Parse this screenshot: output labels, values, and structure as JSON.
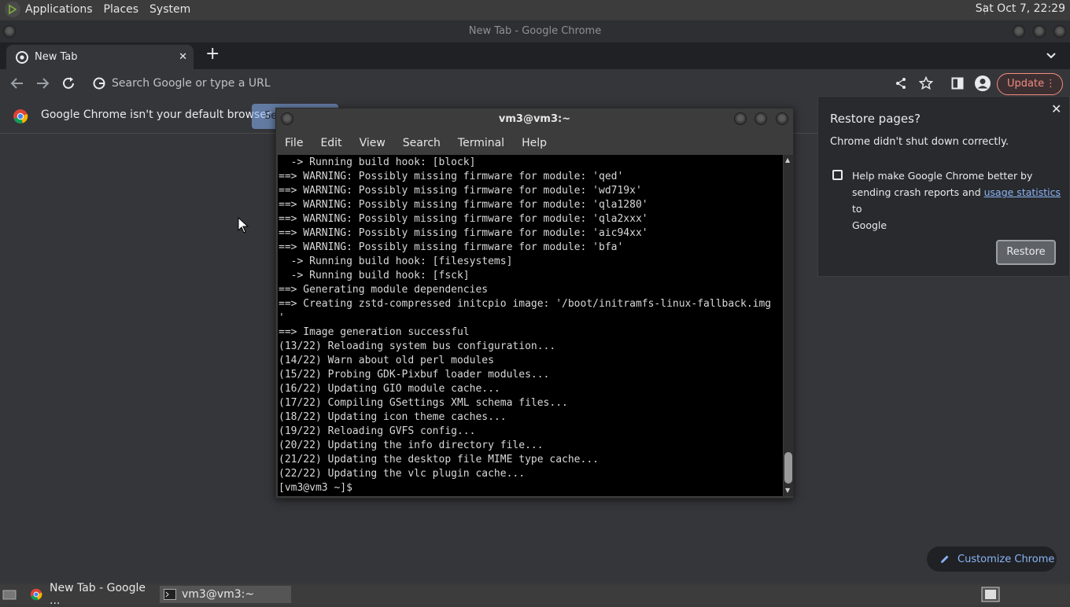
{
  "top_panel": {
    "menus": [
      "Applications",
      "Places",
      "System"
    ],
    "clock": "Sat Oct  7, 22:29"
  },
  "chrome": {
    "window_title": "New Tab - Google Chrome",
    "tab": {
      "title": "New Tab",
      "close": "✕"
    },
    "new_tab": "+",
    "omnibox_placeholder": "Search Google or type a URL",
    "update_label": "Update",
    "infobar": {
      "message": "Google Chrome isn't your default browser",
      "button": "Se"
    },
    "restore": {
      "title": "Restore pages?",
      "subtitle": "Chrome didn't shut down correctly.",
      "checkbox_text_1": "Help make Google Chrome better by",
      "checkbox_text_2a": "sending crash reports and ",
      "link": "usage statistics",
      "checkbox_text_2b": " to",
      "checkbox_text_3": "Google",
      "button": "Restore"
    },
    "customize_label": "Customize Chrome"
  },
  "terminal": {
    "title": "vm3@vm3:~",
    "menus": [
      "File",
      "Edit",
      "View",
      "Search",
      "Terminal",
      "Help"
    ],
    "lines": [
      "  -> Running build hook: [block]",
      "==> WARNING: Possibly missing firmware for module: 'qed'",
      "==> WARNING: Possibly missing firmware for module: 'wd719x'",
      "==> WARNING: Possibly missing firmware for module: 'qla1280'",
      "==> WARNING: Possibly missing firmware for module: 'qla2xxx'",
      "==> WARNING: Possibly missing firmware for module: 'aic94xx'",
      "==> WARNING: Possibly missing firmware for module: 'bfa'",
      "  -> Running build hook: [filesystems]",
      "  -> Running build hook: [fsck]",
      "==> Generating module dependencies",
      "==> Creating zstd-compressed initcpio image: '/boot/initramfs-linux-fallback.img",
      "'",
      "==> Image generation successful",
      "(13/22) Reloading system bus configuration...",
      "(14/22) Warn about old perl modules",
      "(15/22) Probing GDK-Pixbuf loader modules...",
      "(16/22) Updating GIO module cache...",
      "(17/22) Compiling GSettings XML schema files...",
      "(18/22) Updating icon theme caches...",
      "(19/22) Reloading GVFS config...",
      "(20/22) Updating the info directory file...",
      "(21/22) Updating the desktop file MIME type cache...",
      "(22/22) Updating the vlc plugin cache...",
      "[vm3@vm3 ~]$ "
    ]
  },
  "taskbar": {
    "items": [
      "New Tab - Google ...",
      "vm3@vm3:~"
    ]
  }
}
